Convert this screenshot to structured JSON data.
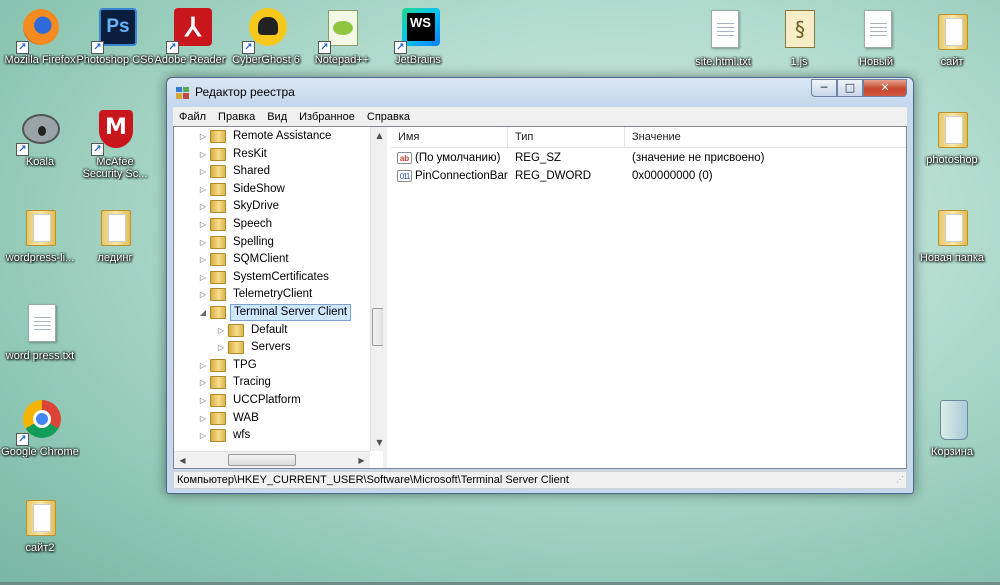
{
  "desktop": {
    "icons": [
      {
        "label": "Mozilla Firefox",
        "icon": "firefox-icon"
      },
      {
        "label": "Photoshop CS6",
        "icon": "photoshop-icon"
      },
      {
        "label": "Adobe Reader",
        "icon": "adobe-reader-icon"
      },
      {
        "label": "CyberGhost 6",
        "icon": "cyberghost-icon"
      },
      {
        "label": "Notepad++",
        "icon": "notepad-plus-icon"
      },
      {
        "label": "JetBrains",
        "icon": "jetbrains-webstorm-icon"
      },
      {
        "label": "site.html.txt",
        "icon": "text-file-icon"
      },
      {
        "label": "1.js",
        "icon": "js-file-icon"
      },
      {
        "label": "Новый",
        "icon": "text-file-icon"
      },
      {
        "label": "сайт",
        "icon": "folder-icon"
      },
      {
        "label": "Koala",
        "icon": "koala-icon"
      },
      {
        "label": "McAfee Security Sc...",
        "icon": "mcafee-icon"
      },
      {
        "label": "photoshop",
        "icon": "folder-icon"
      },
      {
        "label": "wordpress-li...",
        "icon": "folder-icon"
      },
      {
        "label": "лединг",
        "icon": "folder-icon"
      },
      {
        "label": "Новая папка",
        "icon": "folder-icon"
      },
      {
        "label": "word press.txt",
        "icon": "text-file-icon"
      },
      {
        "label": "Google Chrome",
        "icon": "chrome-icon"
      },
      {
        "label": "Корзина",
        "icon": "recycle-bin-icon"
      },
      {
        "label": "сайт2",
        "icon": "folder-icon"
      }
    ]
  },
  "window": {
    "title": "Редактор реестра",
    "buttons": {
      "minimize": "─",
      "maximize": "□",
      "close": "✕"
    },
    "menu": [
      "Файл",
      "Правка",
      "Вид",
      "Избранное",
      "Справка"
    ],
    "tree": [
      {
        "label": "Remote Assistance",
        "level": 0,
        "expander": "▷"
      },
      {
        "label": "ResKit",
        "level": 0,
        "expander": "▷"
      },
      {
        "label": "Shared",
        "level": 0,
        "expander": "▷"
      },
      {
        "label": "SideShow",
        "level": 0,
        "expander": "▷"
      },
      {
        "label": "SkyDrive",
        "level": 0,
        "expander": "▷"
      },
      {
        "label": "Speech",
        "level": 0,
        "expander": "▷"
      },
      {
        "label": "Spelling",
        "level": 0,
        "expander": "▷"
      },
      {
        "label": "SQMClient",
        "level": 0,
        "expander": "▷"
      },
      {
        "label": "SystemCertificates",
        "level": 0,
        "expander": "▷"
      },
      {
        "label": "TelemetryClient",
        "level": 0,
        "expander": "▷"
      },
      {
        "label": "Terminal Server Client",
        "level": 0,
        "expander": "◢",
        "selected": true
      },
      {
        "label": "Default",
        "level": 1,
        "expander": "▷"
      },
      {
        "label": "Servers",
        "level": 1,
        "expander": "▷"
      },
      {
        "label": "TPG",
        "level": 0,
        "expander": "▷"
      },
      {
        "label": "Tracing",
        "level": 0,
        "expander": "▷"
      },
      {
        "label": "UCCPlatform",
        "level": 0,
        "expander": "▷"
      },
      {
        "label": "WAB",
        "level": 0,
        "expander": "▷"
      },
      {
        "label": "wfs",
        "level": 0,
        "expander": "▷"
      }
    ],
    "columns": [
      "Имя",
      "Тип",
      "Значение"
    ],
    "values": [
      {
        "name": "(По умолчанию)",
        "type": "REG_SZ",
        "data": "(значение не присвоено)",
        "icon": "ab"
      },
      {
        "name": "PinConnectionBar",
        "type": "REG_DWORD",
        "data": "0x00000000 (0)",
        "icon": "011"
      }
    ],
    "status": "Компьютер\\HKEY_CURRENT_USER\\Software\\Microsoft\\Terminal Server Client"
  }
}
